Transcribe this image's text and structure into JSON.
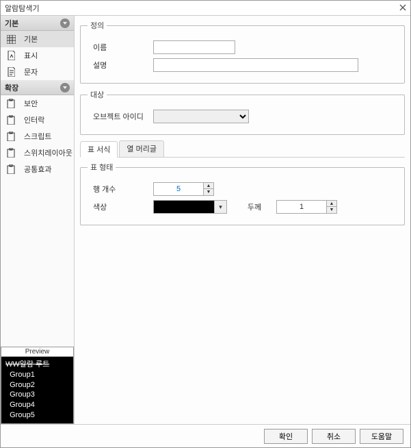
{
  "window": {
    "title": "알람탐색기"
  },
  "sidebar": {
    "sections": [
      {
        "title": "기본",
        "items": [
          {
            "label": "기본"
          },
          {
            "label": "표시"
          },
          {
            "label": "문자"
          }
        ]
      },
      {
        "title": "확장",
        "items": [
          {
            "label": "보안"
          },
          {
            "label": "인터락"
          },
          {
            "label": "스크립트"
          },
          {
            "label": "스위치레이아웃"
          },
          {
            "label": "공통효과"
          }
        ]
      }
    ]
  },
  "preview": {
    "title": "Preview",
    "root": "WW알람  루트",
    "groups": [
      "Group1",
      "Group2",
      "Group3",
      "Group4",
      "Group5"
    ]
  },
  "form": {
    "definition": {
      "legend": "정의",
      "name_label": "이름",
      "name_value": "",
      "desc_label": "설명",
      "desc_value": ""
    },
    "target": {
      "legend": "대상",
      "object_id_label": "오브젝트 아이디",
      "object_id_value": ""
    },
    "tabs": [
      {
        "label": "표 서식"
      },
      {
        "label": "열 머리글"
      }
    ],
    "table_form": {
      "legend": "표 형태",
      "row_count_label": "행 개수",
      "row_count_value": "5",
      "color_label": "색상",
      "color_value": "#000000",
      "thickness_label": "두께",
      "thickness_value": "1"
    }
  },
  "footer": {
    "ok": "확인",
    "cancel": "취소",
    "help": "도움말"
  }
}
